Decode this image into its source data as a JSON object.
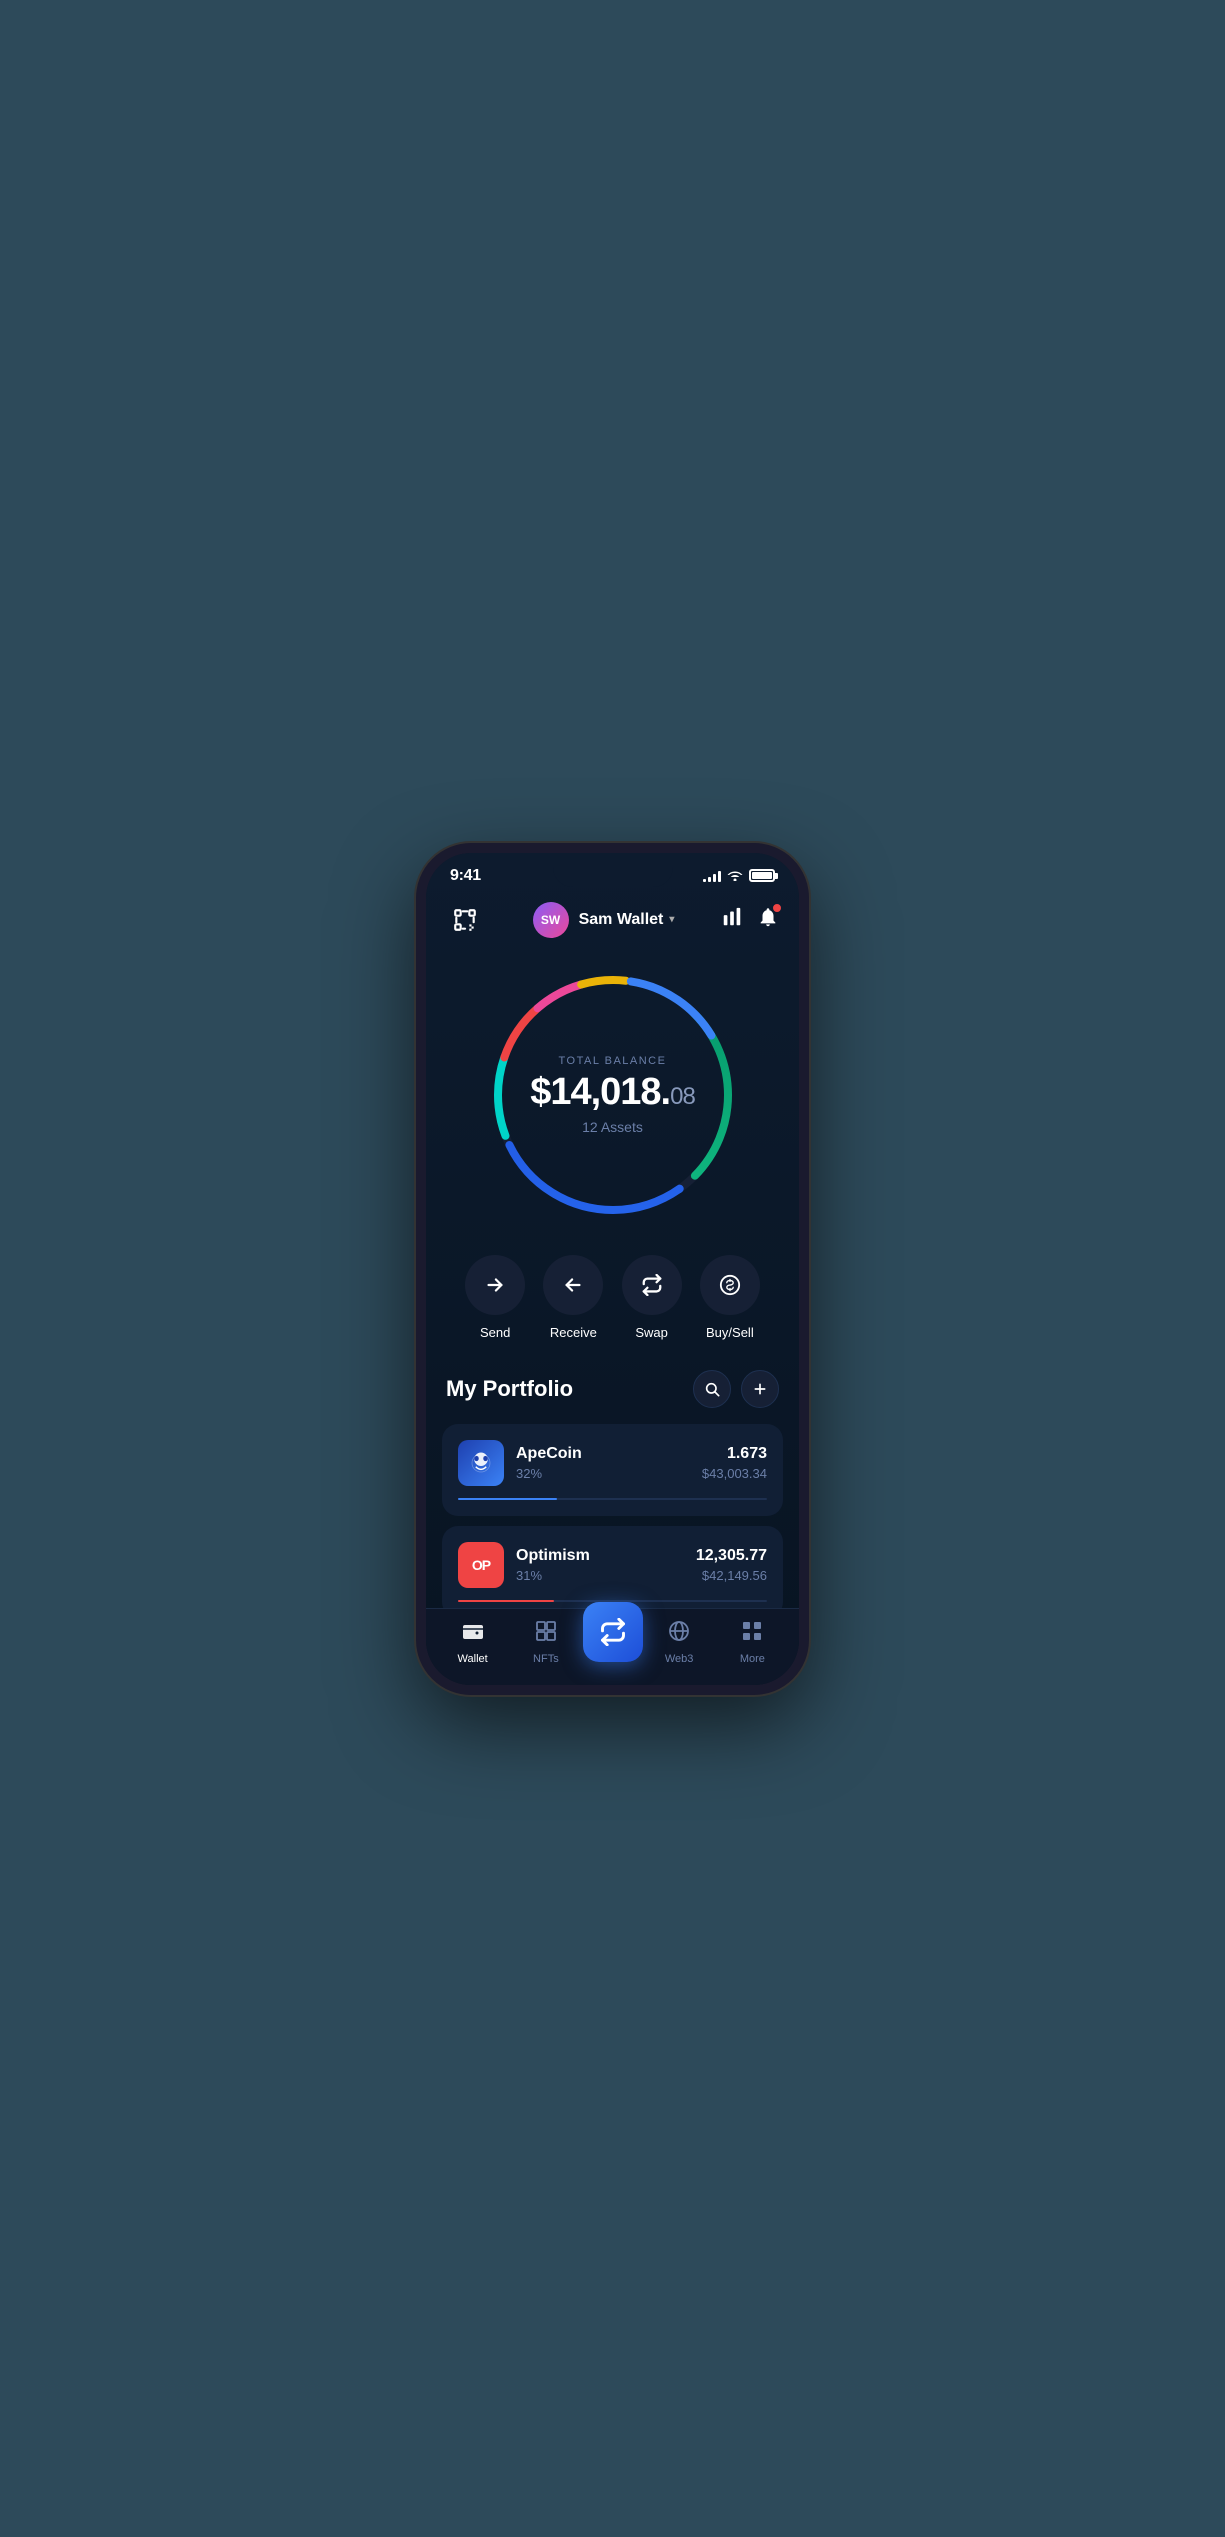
{
  "status_bar": {
    "time": "9:41",
    "signal": [
      3,
      5,
      8,
      10,
      12
    ],
    "battery_full": true
  },
  "header": {
    "scan_label": "scan",
    "avatar_initials": "SW",
    "wallet_name": "Sam Wallet",
    "dropdown_label": "▾",
    "chart_label": "chart",
    "bell_label": "bell"
  },
  "balance": {
    "label": "TOTAL BALANCE",
    "amount": "$14,018.",
    "cents": "08",
    "assets_count": "12 Assets"
  },
  "actions": [
    {
      "id": "send",
      "label": "Send",
      "icon": "→"
    },
    {
      "id": "receive",
      "label": "Receive",
      "icon": "←"
    },
    {
      "id": "swap",
      "label": "Swap",
      "icon": "⇅"
    },
    {
      "id": "buysell",
      "label": "Buy/Sell",
      "icon": "$"
    }
  ],
  "portfolio": {
    "title": "My Portfolio",
    "search_label": "🔍",
    "add_label": "+"
  },
  "assets": [
    {
      "id": "apecoin",
      "name": "ApeCoin",
      "pct": "32%",
      "amount": "1.673",
      "usd": "$43,003.34",
      "progress": 32,
      "color": "#3b82f6",
      "icon_type": "ape"
    },
    {
      "id": "optimism",
      "name": "Optimism",
      "pct": "31%",
      "amount": "12,305.77",
      "usd": "$42,149.56",
      "progress": 31,
      "color": "#ef4444",
      "icon_type": "op"
    }
  ],
  "bottom_nav": [
    {
      "id": "wallet",
      "label": "Wallet",
      "active": true,
      "icon": "wallet"
    },
    {
      "id": "nfts",
      "label": "NFTs",
      "active": false,
      "icon": "nft"
    },
    {
      "id": "center",
      "label": "",
      "active": false,
      "icon": "swap-center"
    },
    {
      "id": "web3",
      "label": "Web3",
      "active": false,
      "icon": "web3"
    },
    {
      "id": "more",
      "label": "More",
      "active": false,
      "icon": "more"
    }
  ],
  "colors": {
    "accent_blue": "#3b82f6",
    "bg_dark": "#0a1628",
    "bg_card": "#111f35",
    "text_muted": "#6b7fa8"
  }
}
